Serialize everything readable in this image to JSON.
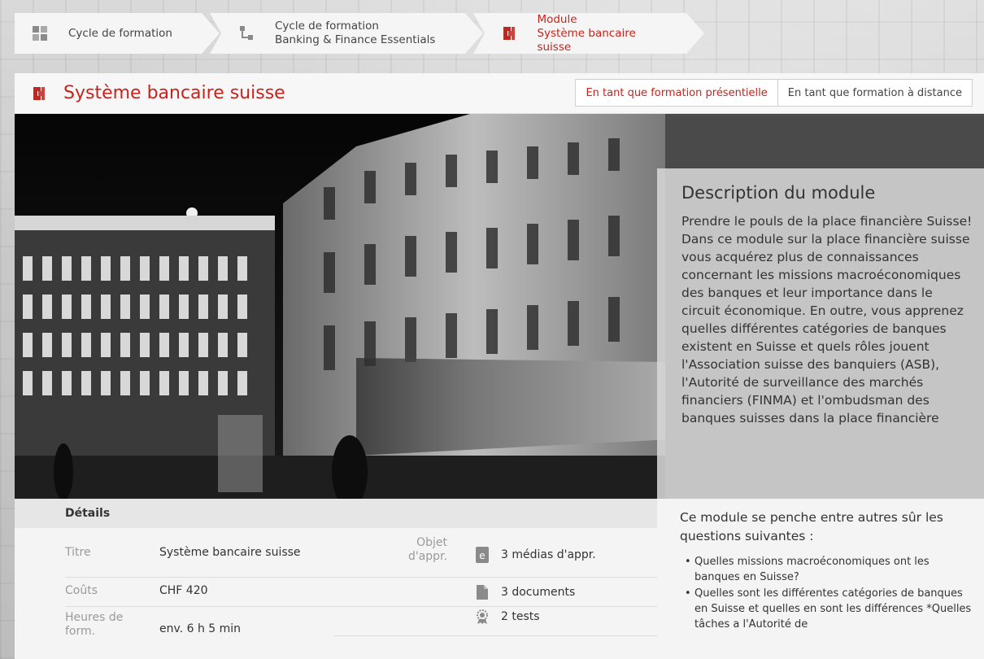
{
  "breadcrumb": [
    {
      "line1": "Cycle de formation",
      "line2": "",
      "icon": "grid-icon"
    },
    {
      "line1": "Cycle de formation",
      "line2": "Banking & Finance Essentials",
      "icon": "hierarchy-icon"
    },
    {
      "line1": "Module",
      "line2": "Système bancaire suisse",
      "icon": "module-icon"
    }
  ],
  "header": {
    "title": "Système bancaire suisse",
    "toggle_present": "En tant que formation présentielle",
    "toggle_distance": "En tant que formation à distance"
  },
  "description": {
    "heading": "Description du module",
    "body": "Prendre le pouls de la place financière Suisse! Dans ce module sur la place financière suisse vous acquérez plus de connaissances concernant les missions macroéconomiques des banques et leur importance dans le circuit économique. En outre, vous apprenez quelles différentes catégories de banques existent en Suisse et quels rôles jouent l'Association suisse des banquiers (ASB), l'Autorité de surveillance des marchés financiers (FINMA) et l'ombudsman des banques suisses dans la place financière",
    "questions_intro": "Ce module se penche entre autres sûr les questions suivantes :",
    "questions": [
      "Quelles missions macroéconomiques ont les banques en Suisse?",
      "Quelles sont les différentes catégories de banques en Suisse et quelles en sont les différences *Quelles tâches a l'Autorité de"
    ]
  },
  "details": {
    "heading": "Détails",
    "title_label": "Titre",
    "title_value": "Système bancaire suisse",
    "cost_label": "Coûts",
    "cost_value": "CHF 420",
    "hours_label": "Heures de form.",
    "hours_value": "env. 6 h 5 min",
    "object_label": "Objet d'appr.",
    "media": "3 médias d'appr.",
    "documents": "3 documents",
    "tests": "2 tests"
  },
  "colors": {
    "accent": "#c8231c"
  }
}
